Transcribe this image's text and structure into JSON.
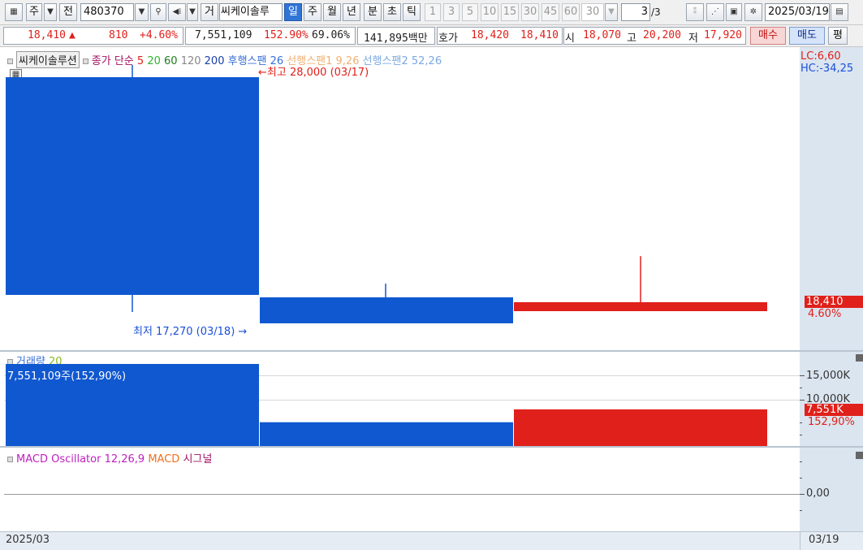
{
  "toolbar": {
    "market_label": "주",
    "jeon_label": "전",
    "code_value": "480370",
    "geo_label": "거",
    "name_value": "씨케이솔루",
    "period_tabs": [
      "일",
      "주",
      "월",
      "년",
      "분",
      "초",
      "틱"
    ],
    "active_period": "일",
    "intervals": [
      "1",
      "3",
      "5",
      "10",
      "15",
      "30",
      "45",
      "60"
    ],
    "interval_select": "30",
    "page_value": "3",
    "page_total": "/3",
    "date_value": "2025/03/19"
  },
  "quote": {
    "price": "18,410",
    "change": "810",
    "change_pct": "+4.60%",
    "volume": "7,551,109",
    "vol_ratio": "152.90%",
    "turnover_pct": "69.06%",
    "amount": "141,895백만",
    "hoga_label": "호가",
    "ask": "18,420",
    "bid": "18,410",
    "open_label": "시",
    "open": "18,070",
    "high_label": "고",
    "high": "20,200",
    "low_label": "저",
    "low": "17,920",
    "buy_label": "매수",
    "sell_label": "매도",
    "avg_label": "평"
  },
  "price_pane": {
    "stock_name": "씨케이솔루션",
    "legend_close": "종가 단순",
    "ma_periods": [
      "5",
      "20",
      "60",
      "120",
      "200"
    ],
    "ma_colors": [
      "#e0201a",
      "#2db52d",
      "#1b7d1b",
      "#888888",
      "#1a3fa8"
    ],
    "ichimoku": [
      "후행스팬 26",
      "선행스팬1 9,26",
      "선행스팬2 52,26"
    ],
    "ichimoku_colors": [
      "#3a6fd8",
      "#f0b070",
      "#7aa8e0"
    ],
    "high_note": "최고 28,000 (03/17)",
    "low_note": "최저 17,270 (03/18)",
    "lc": "LC:6,60",
    "hc": "HC:-34,25",
    "last_price": "18,410",
    "last_pct": "4.60%"
  },
  "volume_pane": {
    "title": "거래량",
    "period": "20",
    "value_note": "7,551,109주(152,90%)",
    "axis_labels": [
      "15,000K",
      "10,000K"
    ],
    "last_vol": "7,551K",
    "last_pct": "152,90%"
  },
  "macd_pane": {
    "osc_label": "MACD Oscillator 12,26,9",
    "macd_label": "MACD",
    "signal_label": "시그널",
    "zero_label": "0,00"
  },
  "footer": {
    "left_date": "2025/03",
    "right_date": "03/19"
  },
  "colors": {
    "up": "#e0201a",
    "down": "#1058d0",
    "accent": "#2f74d6"
  },
  "chart_data": [
    {
      "type": "candlestick",
      "x": [
        "03/17",
        "03/18",
        "03/19"
      ],
      "series": [
        {
          "open": 28000,
          "high": 28000,
          "low": 17270,
          "close": 18070
        },
        {
          "open": 17600,
          "high": 19000,
          "low": 17270,
          "close": 17600
        },
        {
          "open": 18070,
          "high": 20200,
          "low": 17920,
          "close": 18410
        }
      ],
      "colors": [
        "down",
        "down",
        "up"
      ]
    },
    {
      "type": "bar",
      "categories": [
        "03/17",
        "03/18",
        "03/19"
      ],
      "values": [
        16900,
        4900,
        7551
      ],
      "ylim": [
        0,
        18000
      ],
      "unit": "K",
      "colors": [
        "down",
        "down",
        "up"
      ]
    }
  ]
}
